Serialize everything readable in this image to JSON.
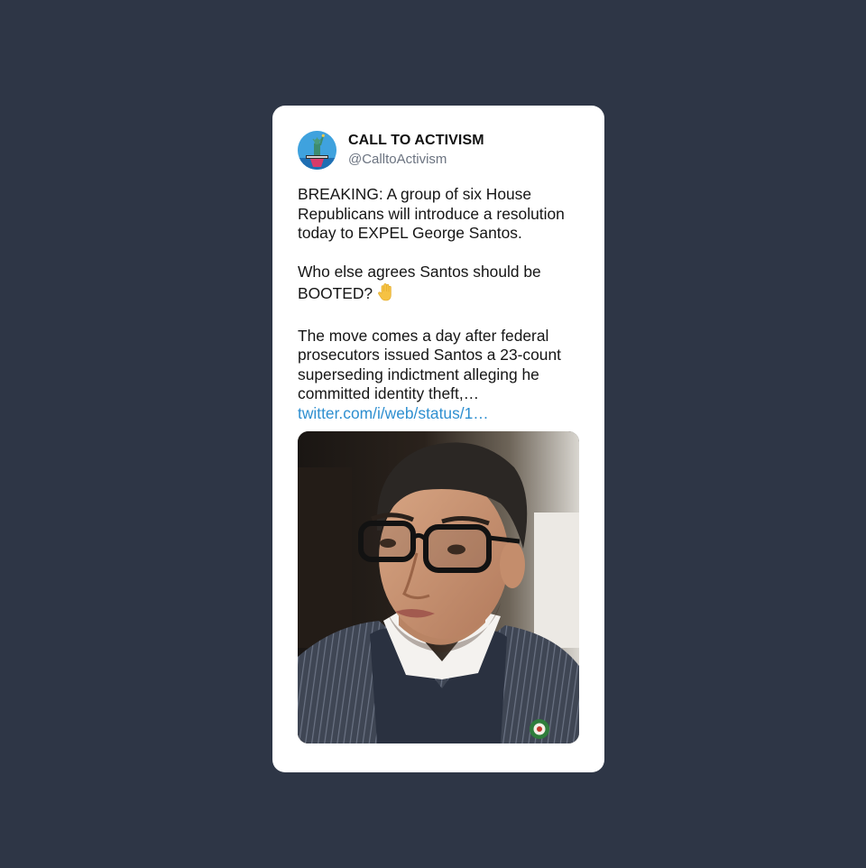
{
  "tweet": {
    "display_name": "CALL TO ACTIVISM",
    "handle": "@CalltoActivism",
    "avatar_icon": "statue-of-liberty-avatar-icon",
    "paragraphs": [
      "BREAKING: A group of six House Republicans will introduce a resolution today to EXPEL George Santos.",
      "Who else agrees Santos should be BOOTED?",
      "The move comes a day after federal prosecutors issued Santos a 23-count superseding indictment alleging he committed identity theft,…"
    ],
    "emoji": "raised-hand-emoji",
    "link": "twitter.com/i/web/status/1…",
    "link_color": "#2e8fd0",
    "media_description_icon": "photo-man-glasses-icon"
  },
  "colors": {
    "background": "#2e3646",
    "card": "#ffffff",
    "text": "#151515",
    "handle": "#6b7380"
  }
}
